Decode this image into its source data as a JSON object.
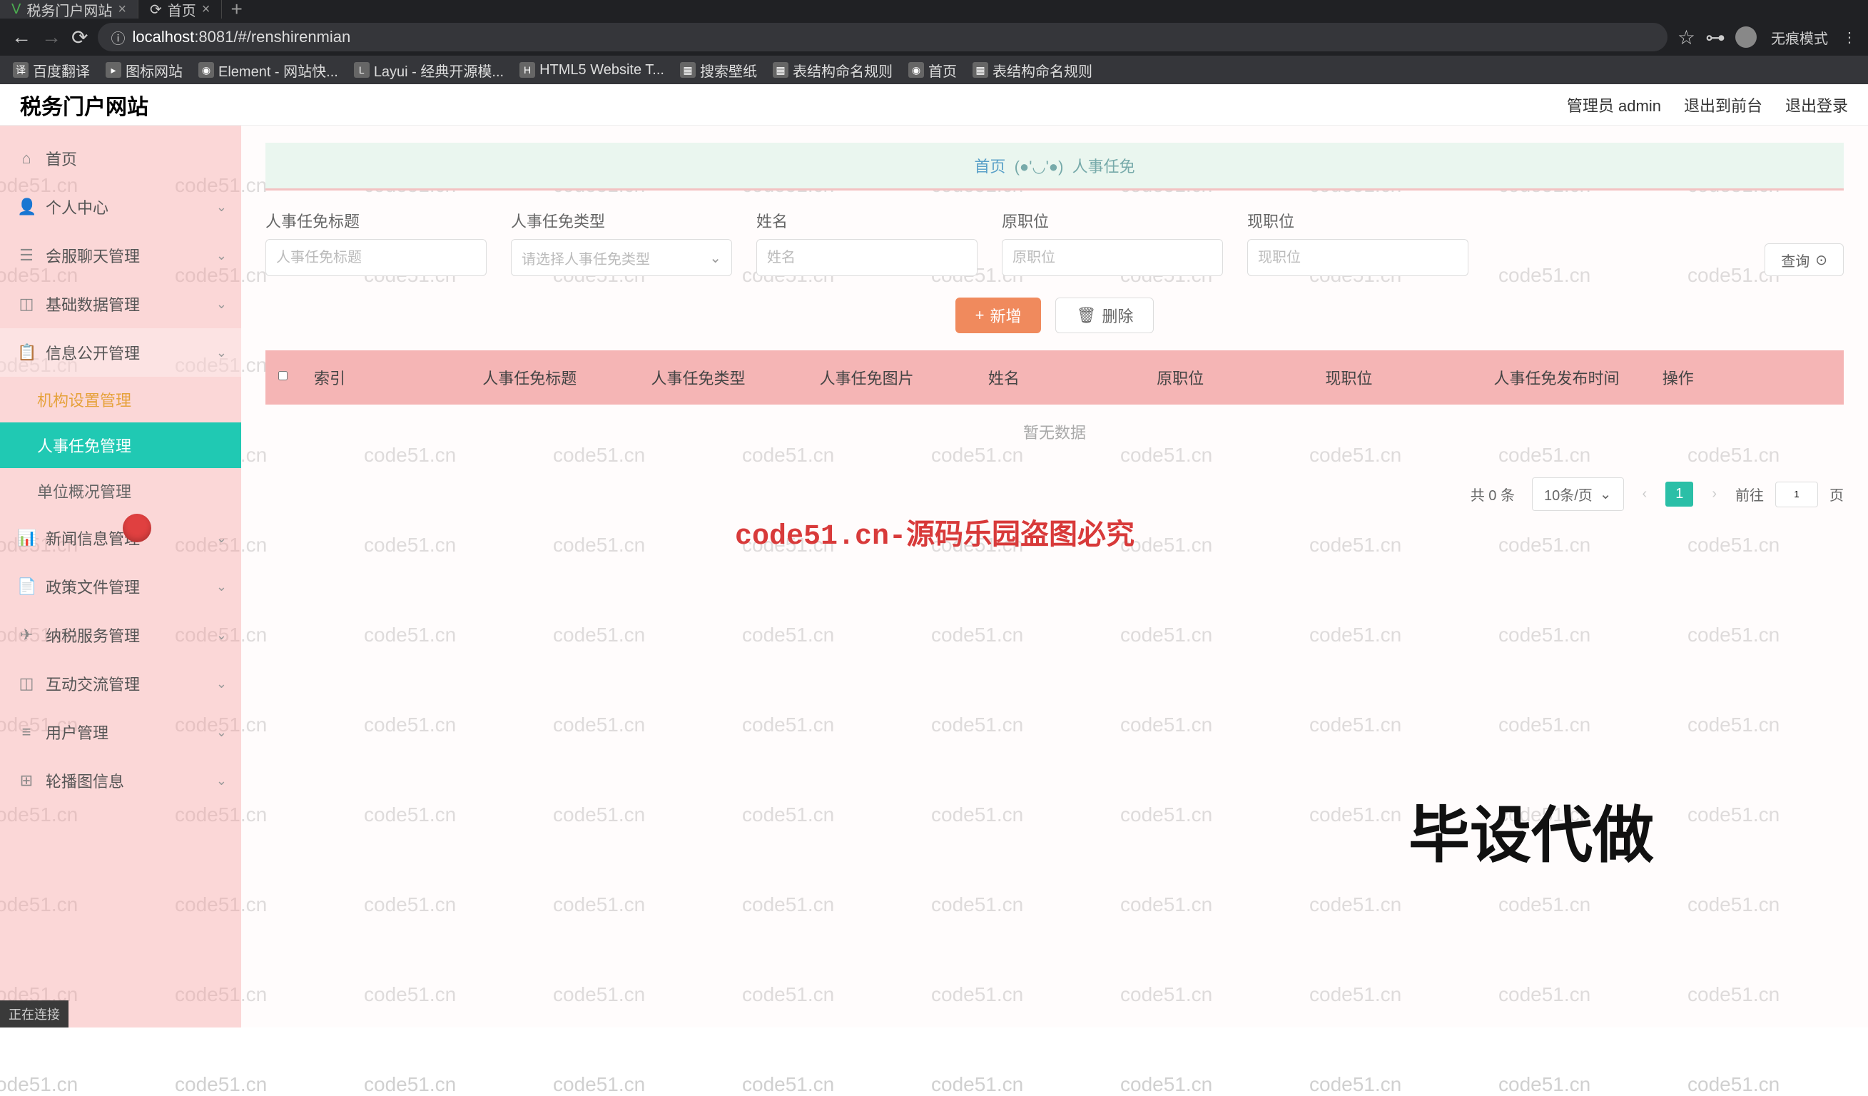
{
  "browser": {
    "tabs": [
      {
        "icon": "V",
        "title": "税务门户网站",
        "active": true
      },
      {
        "icon": "⟳",
        "title": "首页",
        "active": false
      }
    ],
    "url_prefix": "localhost",
    "url_port": ":8081",
    "url_path": "/#/renshirenmian",
    "incognito_label": "无痕模式",
    "bookmarks": [
      {
        "label": "百度翻译",
        "icon": "译"
      },
      {
        "label": "图标网站",
        "icon": "▸"
      },
      {
        "label": "Element - 网站快...",
        "icon": "◉"
      },
      {
        "label": "Layui - 经典开源模...",
        "icon": "L"
      },
      {
        "label": "HTML5 Website T...",
        "icon": "H"
      },
      {
        "label": "搜索壁纸",
        "icon": "▦"
      },
      {
        "label": "表结构命名规则",
        "icon": "▦"
      },
      {
        "label": "首页",
        "icon": "◉"
      },
      {
        "label": "表结构命名规则",
        "icon": "▦"
      }
    ]
  },
  "header": {
    "app_title": "税务门户网站",
    "admin_label": "管理员 admin",
    "exit_front": "退出到前台",
    "logout": "退出登录"
  },
  "sidebar": {
    "items": [
      {
        "icon": "⌂",
        "label": "首页",
        "chev": false
      },
      {
        "icon": "👤",
        "label": "个人中心",
        "chev": true
      },
      {
        "icon": "☰",
        "label": "会服聊天管理",
        "chev": true
      },
      {
        "icon": "◫",
        "label": "基础数据管理",
        "chev": true
      },
      {
        "icon": "📋",
        "label": "信息公开管理",
        "chev": true,
        "expanded": true,
        "children": [
          {
            "label": "机构设置管理",
            "highlight": true
          },
          {
            "label": "人事任免管理",
            "active": true
          },
          {
            "label": "单位概况管理"
          }
        ]
      },
      {
        "icon": "📊",
        "label": "新闻信息管理",
        "chev": true
      },
      {
        "icon": "📄",
        "label": "政策文件管理",
        "chev": true
      },
      {
        "icon": "✈",
        "label": "纳税服务管理",
        "chev": true
      },
      {
        "icon": "◫",
        "label": "互动交流管理",
        "chev": true
      },
      {
        "icon": "≡",
        "label": "用户管理",
        "chev": true
      },
      {
        "icon": "⊞",
        "label": "轮播图信息",
        "chev": true
      }
    ]
  },
  "main": {
    "breadcrumb_home": "首页",
    "breadcrumb_current": "人事任免",
    "filters": [
      {
        "label": "人事任免标题",
        "type": "input",
        "placeholder": "人事任免标题"
      },
      {
        "label": "人事任免类型",
        "type": "select",
        "placeholder": "请选择人事任免类型"
      },
      {
        "label": "姓名",
        "type": "input",
        "placeholder": "姓名"
      },
      {
        "label": "原职位",
        "type": "input",
        "placeholder": "原职位"
      },
      {
        "label": "现职位",
        "type": "input",
        "placeholder": "现职位"
      }
    ],
    "search_label": "查询",
    "add_label": "新增",
    "delete_label": "删除",
    "table_headers": [
      "索引",
      "人事任免标题",
      "人事任免类型",
      "人事任免图片",
      "姓名",
      "原职位",
      "现职位",
      "人事任免发布时间",
      "操作"
    ],
    "empty_text": "暂无数据",
    "pagination": {
      "total_prefix": "共",
      "total_count": "0",
      "total_suffix": "条",
      "page_size": "10条/页",
      "current_page": "1",
      "jump_prefix": "前往",
      "jump_value": "1",
      "jump_suffix": "页"
    }
  },
  "overlay": {
    "watermark_text": "code51.cn",
    "center_text": "code51.cn-源码乐园盗图必究",
    "big_text": "毕设代做"
  },
  "status_bar": "正在连接"
}
